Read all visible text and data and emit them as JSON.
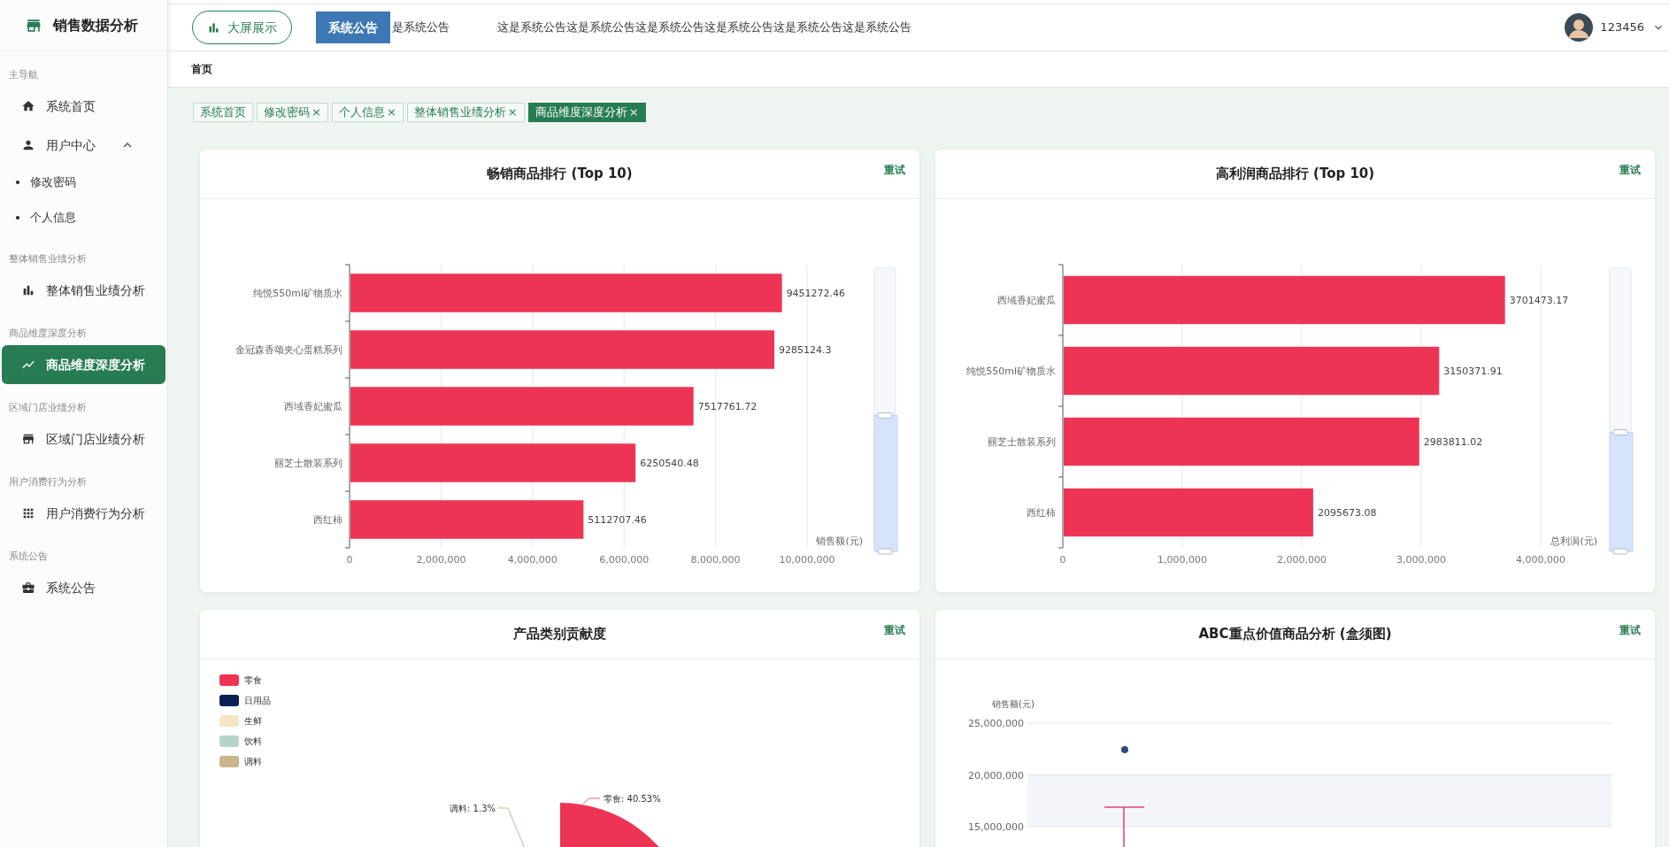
{
  "app": {
    "title": "销售数据分析"
  },
  "nav": [
    {
      "title": "主导航",
      "items": [
        {
          "label": "系统首页",
          "selected": false
        },
        {
          "label": "用户中心",
          "selected": false,
          "expanded": true,
          "children": [
            {
              "label": "修改密码",
              "selected": false
            },
            {
              "label": "个人信息",
              "selected": false
            }
          ]
        }
      ]
    },
    {
      "title": "整体销售业绩分析",
      "items": [
        {
          "label": "整体销售业绩分析",
          "selected": false
        }
      ]
    },
    {
      "title": "商品维度深度分析",
      "items": [
        {
          "label": "商品维度深度分析",
          "selected": true
        }
      ]
    },
    {
      "title": "区域门店业绩分析",
      "items": [
        {
          "label": "区域门店业绩分析",
          "selected": false
        }
      ]
    },
    {
      "title": "用户消费行为分析",
      "items": [
        {
          "label": "用户消费行为分析",
          "selected": false
        }
      ]
    },
    {
      "title": "系统公告",
      "items": [
        {
          "label": "系统公告",
          "selected": false
        }
      ]
    }
  ],
  "header": {
    "big_screen_button": "大屏展示",
    "notice": {
      "label": "系统公告",
      "text_1": "是系统公告",
      "text_2": "这是系统公告这是系统公告这是系统公告这是系统公告这是系统公告这是系统公告"
    },
    "user": {
      "name": "123456"
    }
  },
  "breadcrumb": "首页",
  "tabs": [
    {
      "label": "系统首页",
      "closable": false,
      "selected": false
    },
    {
      "label": "修改密码",
      "closable": true,
      "selected": false
    },
    {
      "label": "个人信息",
      "closable": true,
      "selected": false
    },
    {
      "label": "整体销售业绩分析",
      "closable": true,
      "selected": false
    },
    {
      "label": "商品维度深度分析",
      "closable": true,
      "selected": true
    }
  ],
  "close_mark": "×",
  "bar_cards": [
    {
      "title": "畅销商品排行 (Top 10)",
      "retry": "重试",
      "range_slider": {
        "level": 0.48
      },
      "chart_data": {
        "type": "bar",
        "orientation": "horizontal",
        "xlabel": "销售额(元)",
        "grid": true,
        "categories": [
          "纯悦550ml矿物质水",
          "金冠森香颂夹心蛋糕系列",
          "西域香妃蜜瓜",
          "丽芝士散装系列",
          "西红柿"
        ],
        "series": [
          {
            "color": "#ee3454",
            "values": [
              9451272.46,
              9285124.3,
              7517761.72,
              6250540.48,
              5112707.46
            ]
          }
        ],
        "value_labels": [
          "9451272.46",
          "9285124.3",
          "7517761.72",
          "6250540.48",
          "5112707.46"
        ],
        "xlim": [
          0,
          10000000
        ],
        "xticks": [
          {
            "value": 0,
            "label": "0"
          },
          {
            "value": 2000000,
            "label": "2,000,000"
          },
          {
            "value": 4000000,
            "label": "4,000,000"
          },
          {
            "value": 6000000,
            "label": "6,000,000"
          },
          {
            "value": 8000000,
            "label": "8,000,000"
          },
          {
            "value": 10000000,
            "label": "10,000,000"
          }
        ]
      }
    },
    {
      "title": "高利润商品排行 (Top 10)",
      "retry": "重试",
      "range_slider": {
        "level": 0.42
      },
      "chart_data": {
        "type": "bar",
        "orientation": "horizontal",
        "xlabel": "总利润(元)",
        "grid": true,
        "categories": [
          "西域香妃蜜瓜",
          "纯悦550ml矿物质水",
          "丽芝士散装系列",
          "西红柿"
        ],
        "series": [
          {
            "color": "#ee3454",
            "values": [
              3701473.17,
              3150371.91,
              2983811.02,
              2095673.08
            ]
          }
        ],
        "value_labels": [
          "3701473.17",
          "3150371.91",
          "2983811.02",
          "2095673.08"
        ],
        "xlim": [
          0,
          4000000
        ],
        "xticks": [
          {
            "value": 0,
            "label": "0"
          },
          {
            "value": 1000000,
            "label": "1,000,000"
          },
          {
            "value": 2000000,
            "label": "2,000,000"
          },
          {
            "value": 3000000,
            "label": "3,000,000"
          },
          {
            "value": 4000000,
            "label": "4,000,000"
          }
        ]
      }
    }
  ],
  "pie_card": {
    "title": "产品类别贡献度",
    "retry": "重试",
    "legend": [
      {
        "label": "零食",
        "color": "#ee3454"
      },
      {
        "label": "日用品",
        "color": "#0b1f56"
      },
      {
        "label": "生鲜",
        "color": "#f7e4c2"
      },
      {
        "label": "饮料",
        "color": "#b8d3c9"
      },
      {
        "label": "调料",
        "color": "#c9b48b"
      }
    ],
    "slice_labels": [
      "调料: 1.3%",
      "零食: 40.53%"
    ]
  },
  "box_card": {
    "title": "ABC重点价值商品分析 (盒须图)",
    "retry": "重试",
    "ylabel": "销售额(元)",
    "yticks": [
      "25,000,000",
      "20,000,000",
      "15,000,000"
    ]
  }
}
